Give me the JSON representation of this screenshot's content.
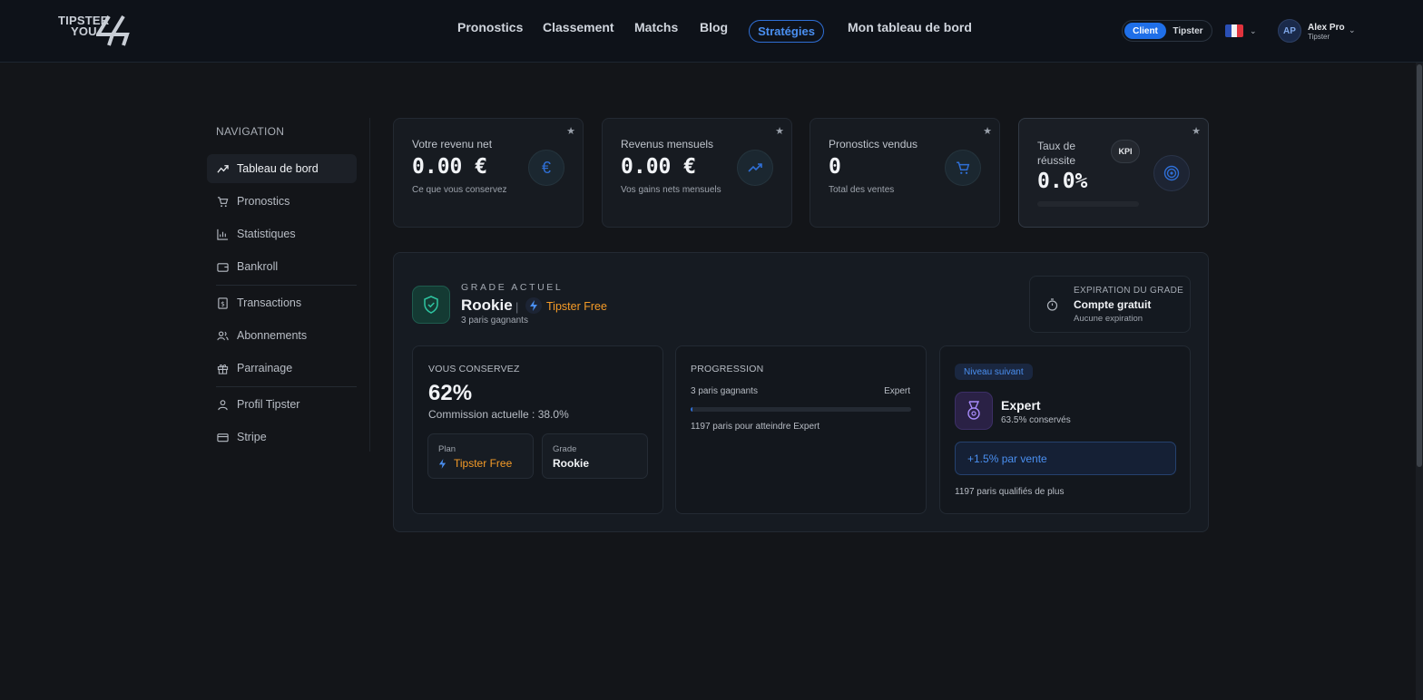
{
  "header": {
    "logo_line1": "TIPSTER",
    "logo_line2": "YOU",
    "nav": [
      "Pronostics",
      "Classement",
      "Matchs",
      "Blog",
      "Stratégies",
      "Mon tableau de bord"
    ],
    "active_nav": "Stratégies",
    "role_toggle": {
      "client": "Client",
      "tipster": "Tipster",
      "selected": "Client"
    },
    "language_flag": "fr-flag-icon",
    "user": {
      "initials": "AP",
      "name": "Alex Pro",
      "role": "Tipster"
    }
  },
  "sidebar": {
    "title": "NAVIGATION",
    "items": [
      {
        "label": "Tableau de bord",
        "icon": "trending-up-icon",
        "active": true
      },
      {
        "label": "Pronostics",
        "icon": "cart-icon"
      },
      {
        "label": "Statistiques",
        "icon": "bar-chart-icon"
      },
      {
        "label": "Bankroll",
        "icon": "wallet-icon"
      },
      {
        "label": "Transactions",
        "icon": "dollar-receipt-icon"
      },
      {
        "label": "Abonnements",
        "icon": "users-icon"
      },
      {
        "label": "Parrainage",
        "icon": "gift-icon"
      },
      {
        "label": "Profil Tipster",
        "icon": "user-icon"
      },
      {
        "label": "Stripe",
        "icon": "credit-card-icon"
      }
    ]
  },
  "kpis": [
    {
      "label": "Votre revenu net",
      "value": "0.00 €",
      "sub": "Ce que vous conservez",
      "icon": "euro-icon"
    },
    {
      "label": "Revenus mensuels",
      "value": "0.00 €",
      "sub": "Vos gains nets mensuels",
      "icon": "trending-up-icon"
    },
    {
      "label": "Pronostics vendus",
      "value": "0",
      "sub": "Total des ventes",
      "icon": "cart-icon"
    },
    {
      "label_line1": "Taux de",
      "label_line2": "réussite",
      "value": "0.0%",
      "badge": "KPI",
      "icon": "target-icon",
      "progress": 0
    }
  ],
  "grade": {
    "eyebrow": "GRADE ACTUEL",
    "name": "Rookie",
    "plan": "Tipster Free",
    "wins": "3 paris gagnants",
    "expiration": {
      "title": "EXPIRATION DU GRADE",
      "value": "Compte gratuit",
      "note": "Aucune expiration"
    },
    "keep": {
      "title": "VOUS CONSERVEZ",
      "percent": "62%",
      "commission": "Commission actuelle : 38.0%",
      "plan_label": "Plan",
      "plan_value": "Tipster Free",
      "grade_label": "Grade",
      "grade_value": "Rookie"
    },
    "progression": {
      "title": "PROGRESSION",
      "left": "3 paris gagnants",
      "right": "Expert",
      "progress": 0.0025,
      "note": "1197 paris pour atteindre Expert"
    },
    "next_level": {
      "pill": "Niveau suivant",
      "name": "Expert",
      "keep": "63.5% conservés",
      "bonus": "+1.5% par vente",
      "qualified": "1197 paris qualifiés de plus"
    }
  },
  "colors": {
    "accent_blue": "#1f6fe8",
    "orange": "#f59b27",
    "green": "#2ec4a0",
    "purple": "#a78bfa"
  }
}
